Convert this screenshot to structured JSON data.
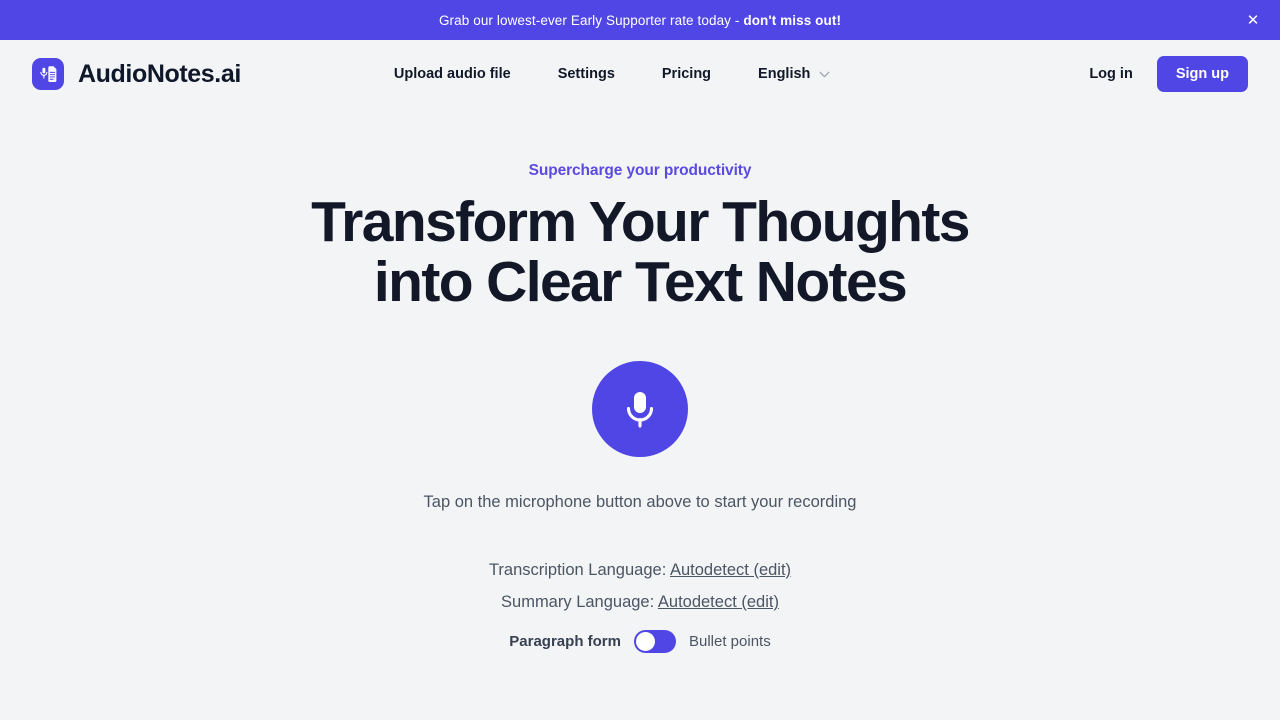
{
  "banner": {
    "text_normal": "Grab our lowest-ever Early Supporter rate today - ",
    "text_bold": "don't miss out!",
    "close_icon": "close-icon",
    "bg_color": "#4f46e5"
  },
  "header": {
    "brand_name": "AudioNotes.ai",
    "logo_icon": "document-microphone-icon",
    "nav": [
      {
        "label": "Upload audio file"
      },
      {
        "label": "Settings"
      },
      {
        "label": "Pricing"
      }
    ],
    "language_selector": {
      "value": "English",
      "chevron_icon": "chevron-down-icon"
    },
    "login_label": "Log in",
    "signup_label": "Sign up",
    "accent_color": "#4f46e5"
  },
  "hero": {
    "eyebrow": "Supercharge your productivity",
    "headline": "Transform Your Thoughts into Clear Text Notes",
    "eyebrow_color": "#5b4ae0",
    "headline_color": "#121827"
  },
  "recorder": {
    "mic_icon": "microphone-icon",
    "mic_button_color": "#4f46e5",
    "hint": "Tap on the microphone button above to start your recording"
  },
  "settings": {
    "transcription_label": "Transcription Language:",
    "transcription_value": "Autodetect (edit)",
    "summary_label": "Summary Language:",
    "summary_value": "Autodetect (edit)",
    "format_toggle": {
      "left_label": "Paragraph form",
      "right_label": "Bullet points",
      "state": "left",
      "track_color": "#4f46e5"
    }
  }
}
